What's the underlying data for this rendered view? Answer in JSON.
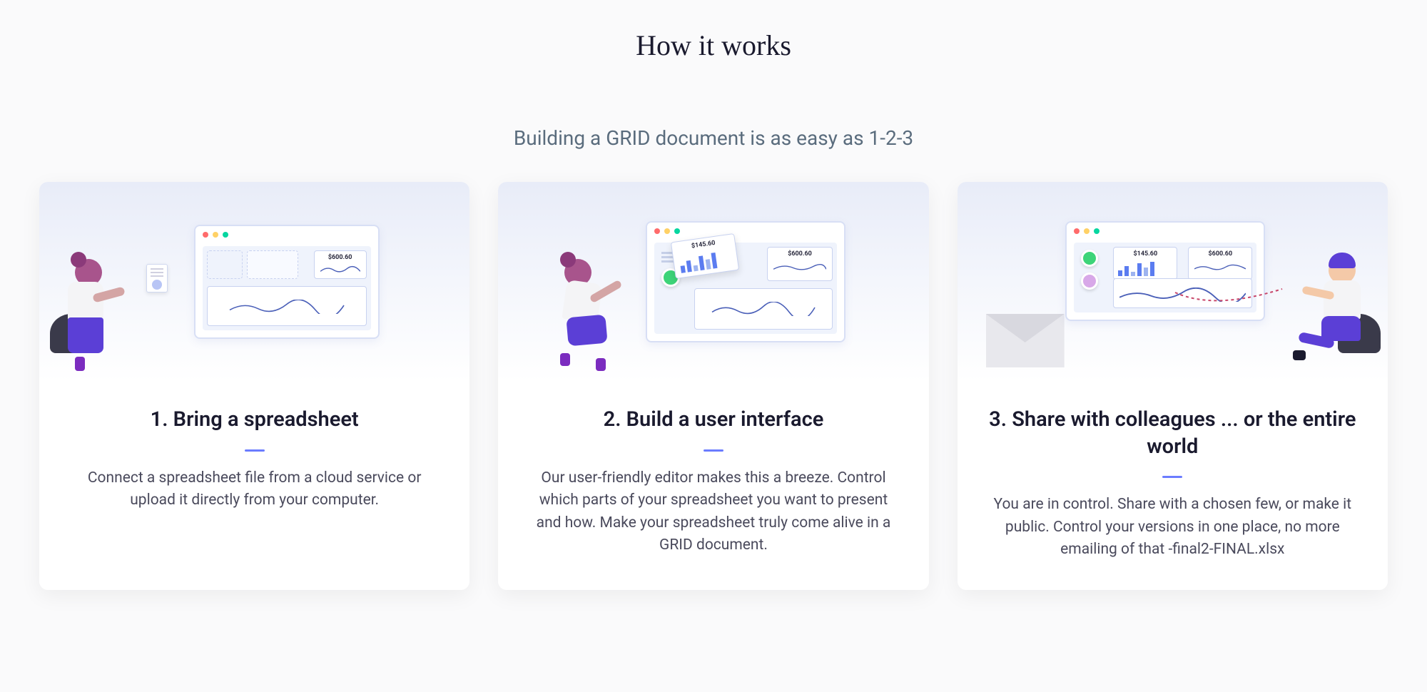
{
  "header": {
    "title": "How it works",
    "subtitle": "Building a GRID document is as easy as 1-2-3"
  },
  "cards": [
    {
      "title": "1. Bring a spreadsheet",
      "description": "Connect a spreadsheet file from a cloud service or upload it directly from your computer.",
      "illustration_labels": {
        "amount1": "$600.60"
      }
    },
    {
      "title": "2. Build a user interface",
      "description": "Our user-friendly editor makes this a breeze. Control which parts of your spreadsheet you want to present and how. Make your spreadsheet truly come alive in a GRID document.",
      "illustration_labels": {
        "amount1": "$145.60",
        "amount2": "$600.60"
      }
    },
    {
      "title": "3. Share with colleagues ... or the entire world",
      "description": "You are in control. Share with a chosen few, or make it public. Control your versions in one place, no more emailing of that -final2-FINAL.xlsx",
      "illustration_labels": {
        "amount1": "$145.60",
        "amount2": "$600.60"
      }
    }
  ]
}
